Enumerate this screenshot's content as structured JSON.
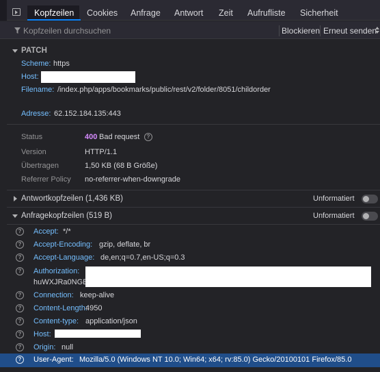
{
  "tabs": [
    "Kopfzeilen",
    "Cookies",
    "Anfrage",
    "Antwort",
    "Zeit",
    "Aufrufliste",
    "Sicherheit"
  ],
  "filter": {
    "placeholder": "Kopfzeilen durchsuchen",
    "block_button": "Blockieren",
    "resend_button": "Erneut senden"
  },
  "request": {
    "method": "PATCH",
    "scheme_label": "Scheme:",
    "scheme_value": "https",
    "host_label": "Host:",
    "filename_label": "Filename:",
    "filename_value": "/index.php/apps/bookmarks/public/rest/v2/folder/8051/childorder",
    "address_label": "Adresse:",
    "address_value": "62.152.184.135:443"
  },
  "status": {
    "status_label": "Status",
    "status_code": "400",
    "status_text": "Bad request",
    "version_label": "Version",
    "version_value": "HTTP/1.1",
    "transferred_label": "Übertragen",
    "transferred_value": "1,50 KB (68 B Größe)",
    "referrer_label": "Referrer Policy",
    "referrer_value": "no-referrer-when-downgrade"
  },
  "response_headers": {
    "title": "Antwortkopfzeilen (1,436 KB)",
    "raw_label": "Unformatiert"
  },
  "request_headers": {
    "title": "Anfragekopfzeilen (519 B)",
    "raw_label": "Unformatiert",
    "items": [
      {
        "key": "Accept:",
        "value": "*/*"
      },
      {
        "key": "Accept-Encoding:",
        "value": "gzip, deflate, br"
      },
      {
        "key": "Accept-Language:",
        "value": "de,en;q=0.7,en-US;q=0.3"
      },
      {
        "key": "Authorization:",
        "value": "huWXJRa0NGE"
      },
      {
        "key": "Connection:",
        "value": "keep-alive"
      },
      {
        "key": "Content-Length:",
        "value": "4950"
      },
      {
        "key": "Content-type:",
        "value": "application/json"
      },
      {
        "key": "Host:",
        "value": ""
      },
      {
        "key": "Origin:",
        "value": "null"
      },
      {
        "key": "User-Agent:",
        "value": "Mozilla/5.0 (Windows NT 10.0; Win64; x64; rv:85.0) Gecko/20100101 Firefox/85.0"
      }
    ]
  },
  "colors": {
    "background": "#232327",
    "accent": "#0a84ff",
    "header_key": "#75bfff",
    "status_code": "#d68bff",
    "selected_row": "#204e8a"
  }
}
